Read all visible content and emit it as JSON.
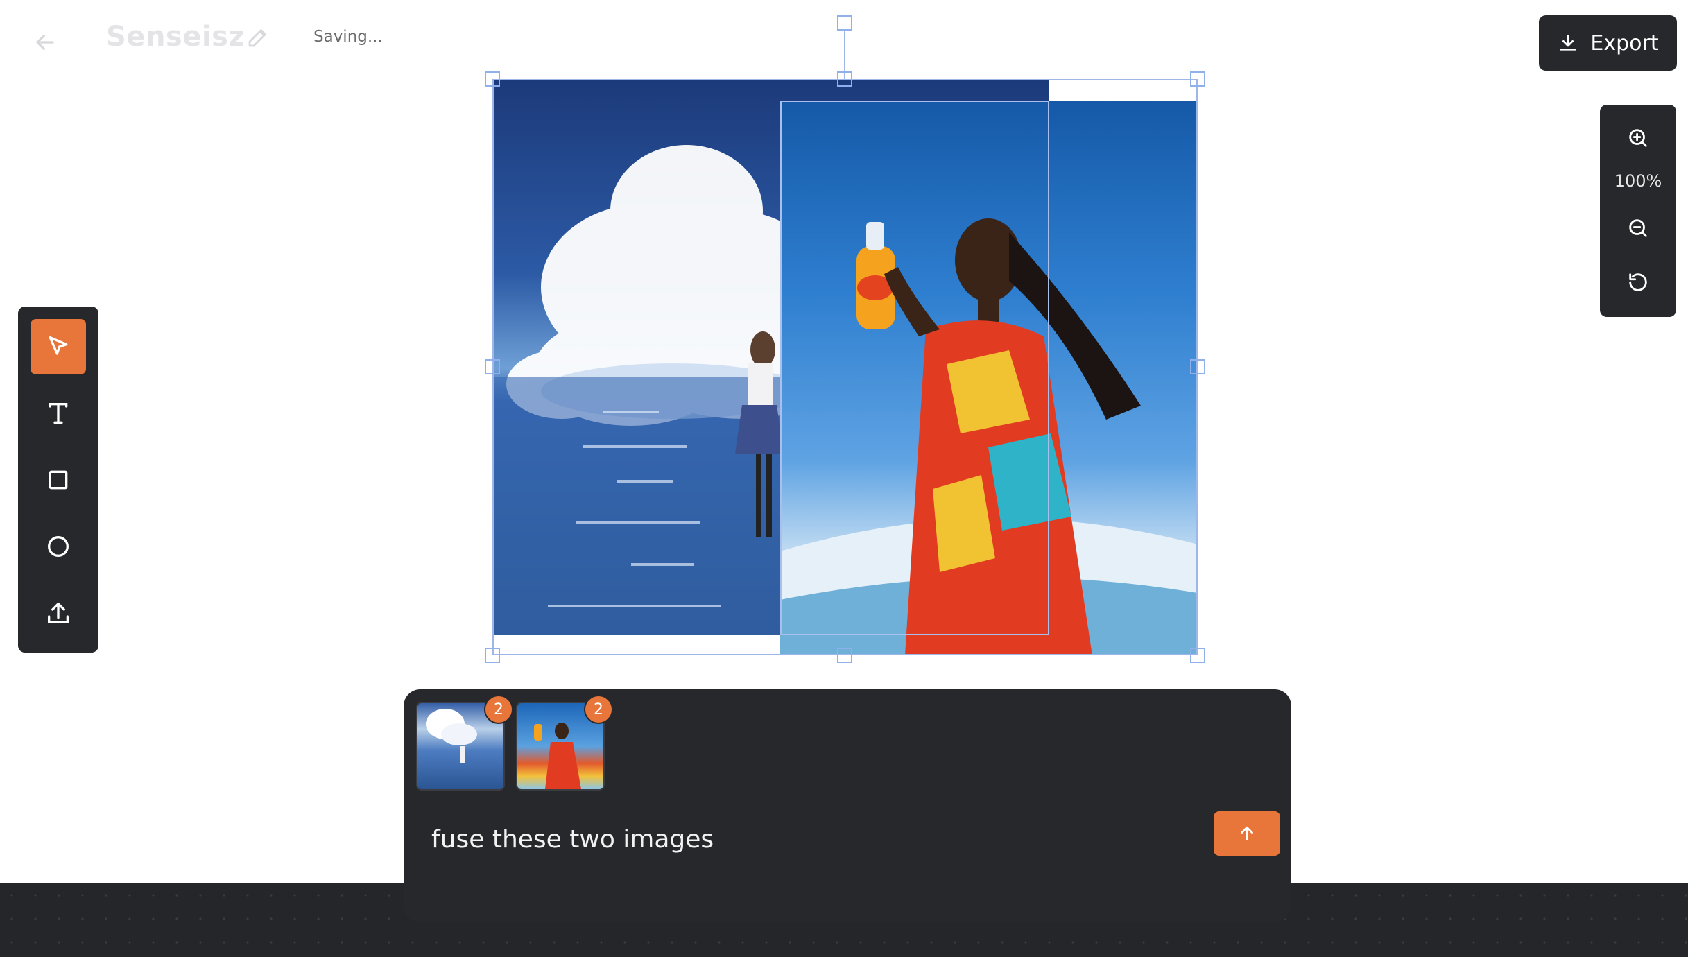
{
  "header": {
    "title": "Senseisz",
    "status": "Saving...",
    "export_label": "Export"
  },
  "zoom": {
    "level": "100%"
  },
  "tools": [
    "select",
    "text",
    "rectangle",
    "ellipse",
    "upload"
  ],
  "prompt": {
    "text": "fuse these two images",
    "attachments": [
      {
        "badge": "2"
      },
      {
        "badge": "2"
      }
    ]
  },
  "colors": {
    "accent": "#e8753a",
    "panel": "#27282c",
    "selection": "#9eb7e8"
  },
  "icons": [
    "back-arrow-icon",
    "pencil-icon",
    "download-icon",
    "zoom-in-icon",
    "zoom-out-icon",
    "reset-icon",
    "cursor-icon",
    "text-icon",
    "square-icon",
    "circle-icon",
    "upload-icon",
    "arrow-up-icon"
  ]
}
